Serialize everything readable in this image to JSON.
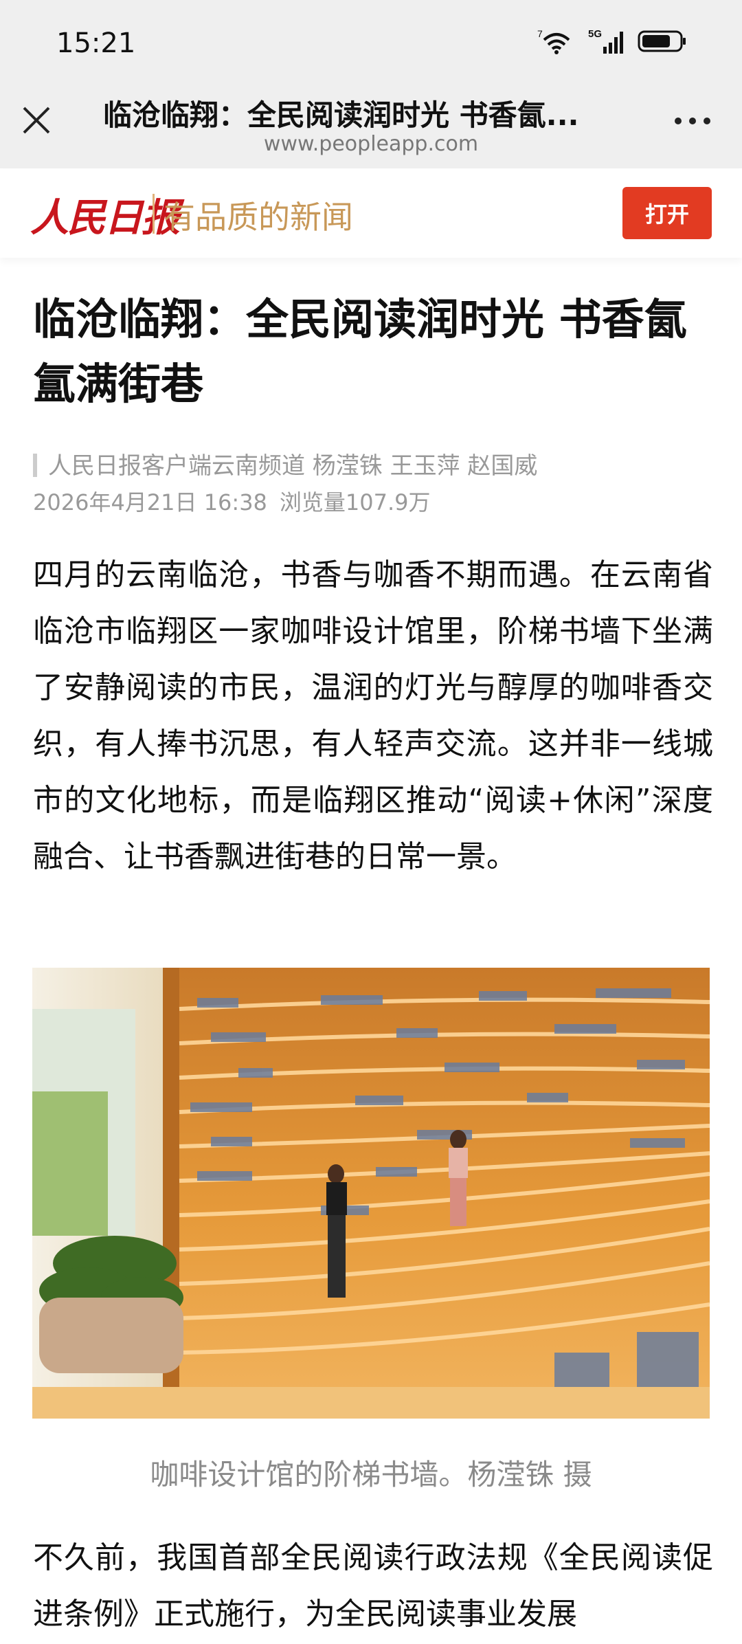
{
  "status_bar": {
    "time": "15:21",
    "wifi_badge": "7",
    "network": "5G",
    "icons": [
      "wifi-icon",
      "signal-icon",
      "battery-icon"
    ]
  },
  "browser": {
    "title": "临沧临翔：全民阅读润时光 书香氤...",
    "url": "www.peopleapp.com",
    "close_icon": "close-icon",
    "more_icon": "more-icon"
  },
  "app_banner": {
    "logo_text": "人民日报",
    "slogan": "有品质的新闻",
    "open_label": "打开",
    "accent": "#e23b22"
  },
  "article": {
    "title": "临沧临翔：全民阅读润时光 书香氤氲满街巷",
    "byline": "人民日报客户端云南频道 杨滢铢 王玉萍 赵国威",
    "date": "2026年4月21日 16:38",
    "views": "浏览量107.9万",
    "paragraph_1": "四月的云南临沧，书香与咖香不期而遇。在云南省临沧市临翔区一家咖啡设计馆里，阶梯书墙下坐满了安静阅读的市民，温润的灯光与醇厚的咖啡香交织，有人捧书沉思，有人轻声交流。这并非一线城市的文化地标，而是临翔区推动“阅读+休闲”深度融合、让书香飘进街巷的日常一景。",
    "image_caption": "咖啡设计馆的阶梯书墙。杨滢铢 摄",
    "paragraph_2": "不久前，我国首部全民阅读行政法规《全民阅读促进条例》正式施行，为全民阅读事业发展"
  }
}
